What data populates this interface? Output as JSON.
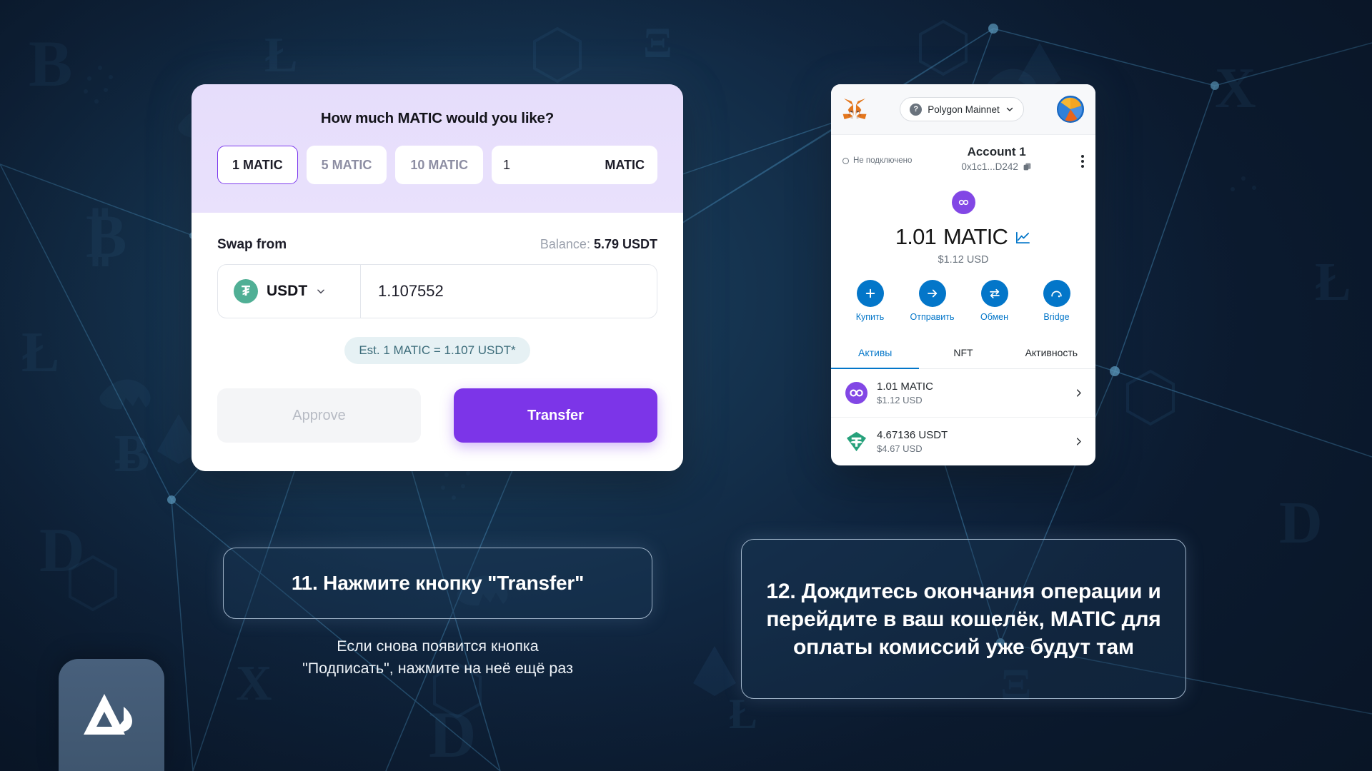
{
  "swap_card": {
    "title": "How much MATIC would you like?",
    "presets": [
      {
        "label": "1 MATIC",
        "active": true
      },
      {
        "label": "5 MATIC",
        "active": false
      },
      {
        "label": "10 MATIC",
        "active": false
      }
    ],
    "amount_input": {
      "value": "1",
      "unit": "MATIC",
      "placeholder": "0"
    },
    "swap_from_label": "Swap from",
    "balance_prefix": "Balance: ",
    "balance_value": "5.79 USDT",
    "token": {
      "symbol": "USDT",
      "icon": "tether-icon",
      "chevron": "chevron-down-icon"
    },
    "token_amount": {
      "value": "1.107552",
      "placeholder": "0.0"
    },
    "estimate": "Est. 1 MATIC = 1.107 USDT*",
    "approve_label": "Approve",
    "transfer_label": "Transfer",
    "accent_purple": "#7c35e8",
    "header_bg": "#e7dffb"
  },
  "metamask": {
    "fox_icon": "metamask-fox-icon",
    "network": {
      "label": "Polygon Mainnet",
      "help_icon": "question-mark-icon",
      "chevron": "chevron-down-icon"
    },
    "avatar": "account-avatar-icon",
    "connection_status": "Не подключено",
    "account_name": "Account 1",
    "account_address": "0x1c1...D242",
    "copy_icon": "copy-icon",
    "menu_icon": "kebab-menu-icon",
    "token_badge_icon": "polygon-icon",
    "balance_amount": "1.01",
    "balance_symbol": "MATIC",
    "balance_chart_icon": "line-chart-icon",
    "balance_fiat": "$1.12 USD",
    "actions": [
      {
        "label": "Купить",
        "icon": "plus-icon"
      },
      {
        "label": "Отправить",
        "icon": "arrow-right-icon"
      },
      {
        "label": "Обмен",
        "icon": "swap-arrows-icon"
      },
      {
        "label": "Bridge",
        "icon": "bridge-icon"
      }
    ],
    "tabs": [
      {
        "label": "Активы",
        "active": true
      },
      {
        "label": "NFT",
        "active": false
      },
      {
        "label": "Активность",
        "active": false
      }
    ],
    "assets": [
      {
        "icon": "polygon-icon",
        "amount": "1.01 MATIC",
        "fiat": "$1.12 USD",
        "chevron": "chevron-right-icon"
      },
      {
        "icon": "tether-icon",
        "amount": "4.67136 USDT",
        "fiat": "$4.67 USD",
        "chevron": "chevron-right-icon"
      }
    ],
    "accent_blue": "#0376c9"
  },
  "captions": {
    "left_title": "11. Нажмите кнопку \"Transfer\"",
    "left_subtitle_line1": "Если снова появится кнопка",
    "left_subtitle_line2": "\"Подписать\", нажмите на неё ещё раз",
    "right_text": "12. Дождитесь окончания операции и перейдите в ваш кошелёк, MATIC для оплаты комиссий уже будут там"
  },
  "branding": {
    "logo_icon": "mountain-flame-logo-icon"
  }
}
